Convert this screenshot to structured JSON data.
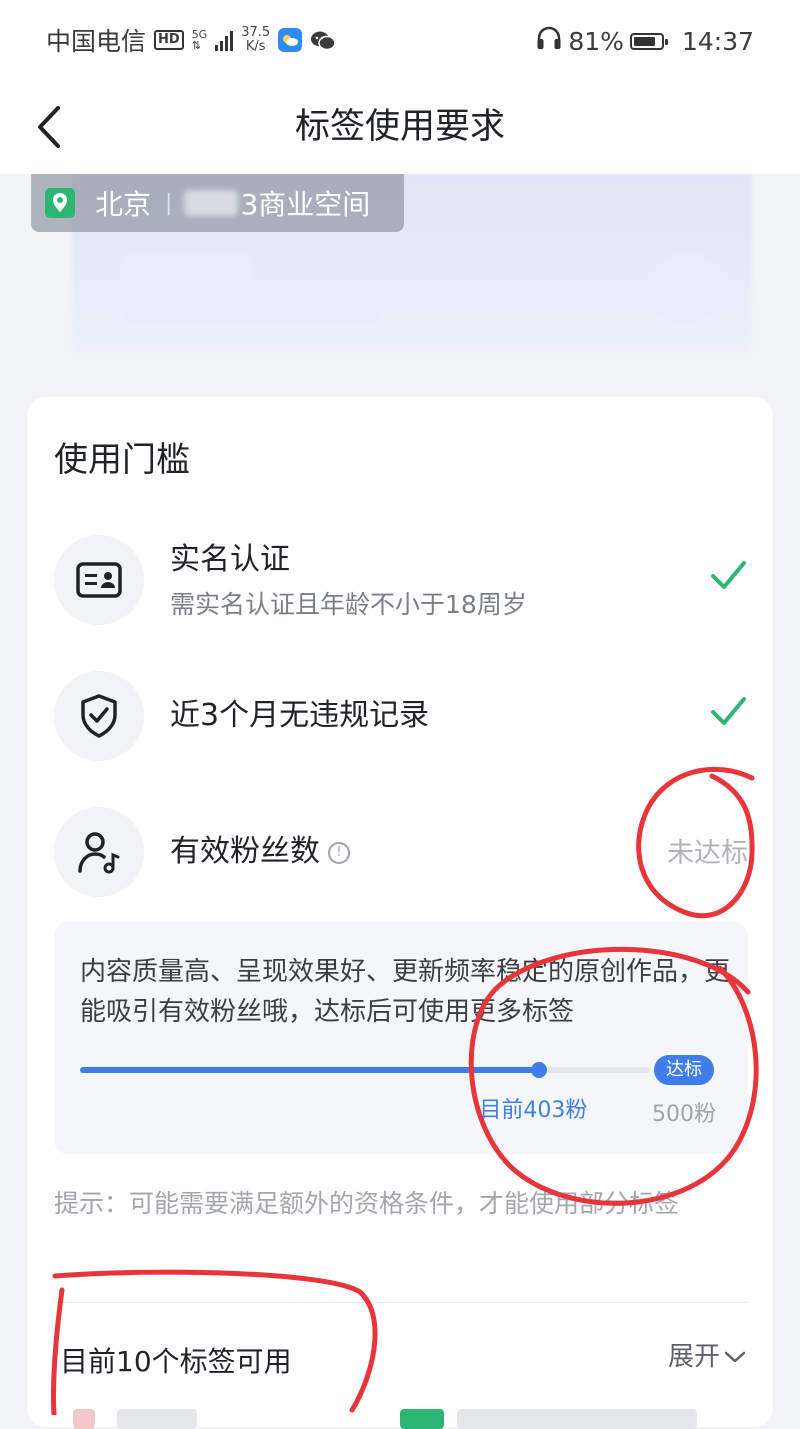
{
  "status_bar": {
    "carrier": "中国电信",
    "hd": "HD",
    "network": "5G",
    "speed_top": "37.5",
    "speed_unit": "K/s",
    "battery_percent": "81%",
    "battery_level": 0.81,
    "time": "14:37"
  },
  "nav": {
    "title": "标签使用要求"
  },
  "location": {
    "city": "北京",
    "separator": "|",
    "place": "3商业空间"
  },
  "threshold": {
    "title": "使用门槛",
    "items": [
      {
        "icon": "id-card-icon",
        "title": "实名认证",
        "desc": "需实名认证且年龄不小于18周岁",
        "status": "check"
      },
      {
        "icon": "shield-check-icon",
        "title": "近3个月无违规记录",
        "status": "check"
      },
      {
        "icon": "user-music-icon",
        "title": "有效粉丝数",
        "info": "!",
        "status": "未达标"
      }
    ],
    "fans": {
      "text": "内容质量高、呈现效果好、更新频率稳定的原创作品，更能吸引有效粉丝哦，达标后可使用更多标签",
      "current_label": "目前403粉",
      "goal_badge": "达标",
      "goal_label": "500粉",
      "current": 403,
      "goal": 500
    },
    "tip": "提示：可能需要满足额外的资格条件，才能使用部分标签"
  },
  "available": {
    "title": "目前10个标签可用",
    "expand_label": "展开"
  },
  "colors": {
    "accent": "#3f7ee8",
    "success": "#2bb673",
    "annotation": "#e8353a"
  }
}
